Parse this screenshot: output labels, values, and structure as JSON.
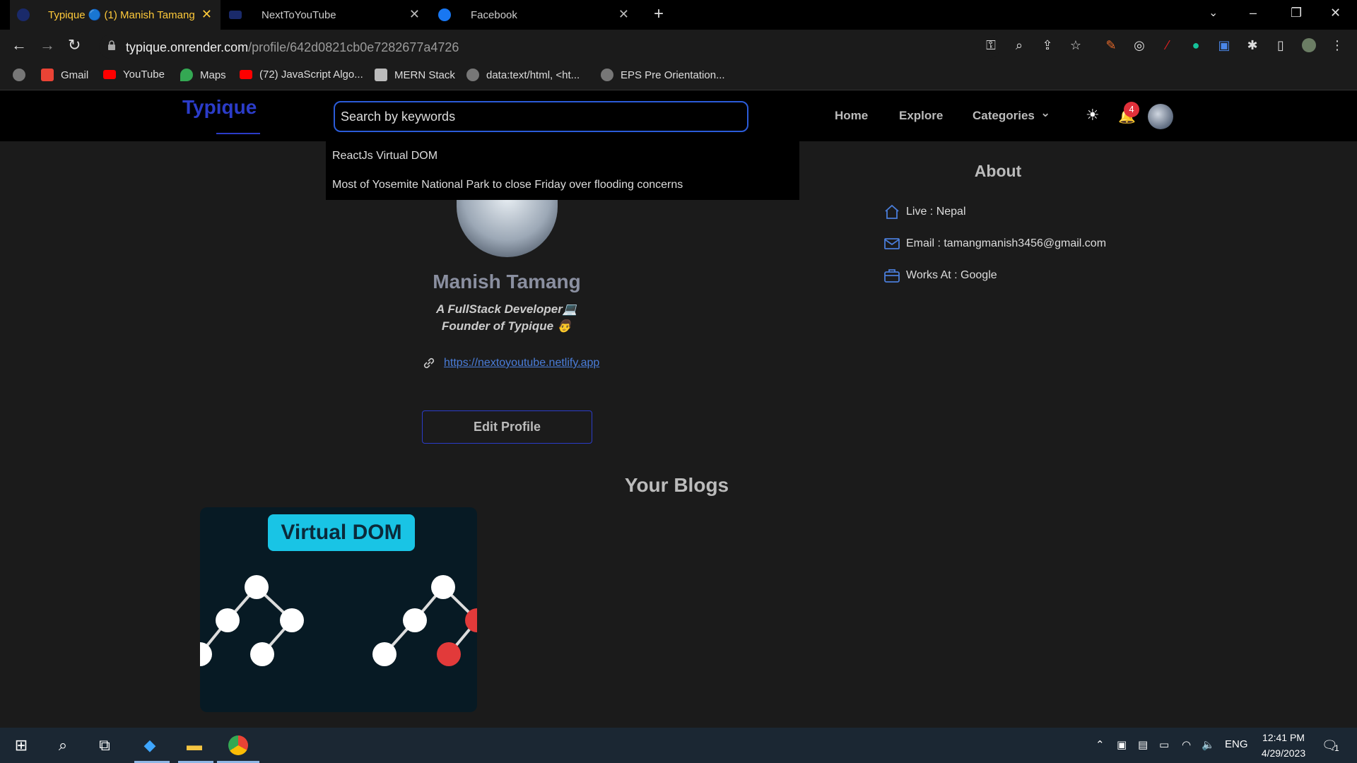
{
  "browser": {
    "tabs": [
      {
        "title": "Typique 🔵 (1) Manish Tamang",
        "active": true
      },
      {
        "title": "NextToYouTube",
        "active": false
      },
      {
        "title": "Facebook",
        "active": false
      }
    ],
    "url_host": "typique.onrender.com",
    "url_path": "/profile/642d0821cb0e7282677a4726",
    "bookmarks": [
      {
        "label": "Gmail",
        "icon": "gmail-icon"
      },
      {
        "label": "YouTube",
        "icon": "youtube-icon"
      },
      {
        "label": "Maps",
        "icon": "maps-icon"
      },
      {
        "label": "(72) JavaScript Algo...",
        "icon": "youtube-icon"
      },
      {
        "label": "MERN Stack",
        "icon": "folder-icon"
      },
      {
        "label": "data:text/html, <ht...",
        "icon": "globe-icon"
      },
      {
        "label": "EPS Pre Orientation...",
        "icon": "globe-icon"
      }
    ]
  },
  "app": {
    "logo": "Typique",
    "search_placeholder": "Search by keywords",
    "nav": {
      "home": "Home",
      "explore": "Explore",
      "categories": "Categories"
    },
    "notification_count": "4",
    "search_results": [
      "ReactJs Virtual DOM",
      "Most of Yosemite National Park to close Friday over flooding concerns"
    ]
  },
  "profile": {
    "name": "Manish Tamang",
    "bio_line1": "A FullStack Developer💻",
    "bio_line2": "Founder of Typique 👨",
    "link": "https://nextoyoutube.netlify.app",
    "edit_button": "Edit Profile"
  },
  "about": {
    "title": "About",
    "live": "Live : Nepal",
    "email": "Email : tamangmanish3456@gmail.com",
    "works": "Works At : Google"
  },
  "blogs": {
    "title": "Your Blogs",
    "cards": [
      {
        "image_text": "Virtual DOM"
      }
    ]
  },
  "taskbar": {
    "language": "ENG",
    "time": "12:41 PM",
    "date": "4/29/2023",
    "notifications": "1"
  },
  "colors": {
    "brand": "#2b3cc9",
    "tab_active_text": "#ffca3a",
    "badge": "#e0303a"
  }
}
